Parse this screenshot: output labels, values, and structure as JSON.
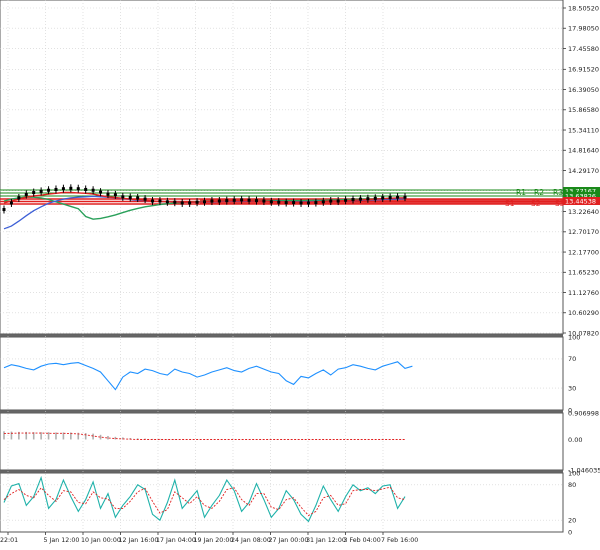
{
  "chart_data": {
    "type": "line",
    "main": {
      "y_ticks": [
        "18.50520",
        "17.98050",
        "17.45580",
        "16.91520",
        "16.39050",
        "15.86580",
        "15.34110",
        "14.81640",
        "14.29170",
        "13.76700",
        "13.22640",
        "12.70170",
        "12.17700",
        "11.65230",
        "11.12760",
        "10.60290",
        "10.07820"
      ],
      "y_tick_values": [
        18.5052,
        17.9805,
        17.4558,
        16.9152,
        16.3905,
        15.8658,
        15.3411,
        14.8164,
        14.2917,
        13.767,
        13.2264,
        12.7017,
        12.177,
        11.6523,
        11.1276,
        10.6029,
        10.0782
      ],
      "ylim": [
        10.0782,
        18.5052
      ],
      "current_price_labels": [
        "13.77167",
        "13.63826",
        "13.44538"
      ],
      "level_labels": [
        "R1",
        "R2",
        "R3",
        "S1",
        "S2",
        "S3"
      ],
      "price_series": [
        13.28,
        13.45,
        13.58,
        13.67,
        13.72,
        13.75,
        13.78,
        13.8,
        13.82,
        13.83,
        13.82,
        13.8,
        13.78,
        13.73,
        13.68,
        13.66,
        13.61,
        13.59,
        13.58,
        13.55,
        13.5,
        13.5,
        13.48,
        13.47,
        13.45,
        13.45,
        13.47,
        13.48,
        13.5,
        13.5,
        13.51,
        13.52,
        13.53,
        13.52,
        13.51,
        13.5,
        13.48,
        13.47,
        13.46,
        13.46,
        13.45,
        13.45,
        13.46,
        13.48,
        13.5,
        13.5,
        13.52,
        13.54,
        13.55,
        13.56,
        13.57,
        13.58,
        13.59,
        13.6,
        13.6
      ],
      "ma_blue": [
        12.78,
        12.85,
        12.98,
        13.12,
        13.25,
        13.35,
        13.44,
        13.5,
        13.55,
        13.58,
        13.6,
        13.61,
        13.62,
        13.61,
        13.6,
        13.58,
        13.56,
        13.54,
        13.52,
        13.51,
        13.5,
        13.49,
        13.48,
        13.48,
        13.47,
        13.47,
        13.47,
        13.48,
        13.48,
        13.49,
        13.49,
        13.5,
        13.5,
        13.5,
        13.5,
        13.5,
        13.49,
        13.49,
        13.48,
        13.48,
        13.48,
        13.48,
        13.49,
        13.49,
        13.5,
        13.5,
        13.51,
        13.51,
        13.52,
        13.53,
        13.53,
        13.54,
        13.55,
        13.55,
        13.56
      ],
      "ma_red": [
        13.45,
        13.5,
        13.55,
        13.6,
        13.63,
        13.65,
        13.68,
        13.7,
        13.72,
        13.72,
        13.71,
        13.7,
        13.68,
        13.64,
        13.61,
        13.59,
        13.57,
        13.55,
        13.54,
        13.52,
        13.5,
        13.49,
        13.48,
        13.48,
        13.47,
        13.47,
        13.47,
        13.48,
        13.49,
        13.5,
        13.5,
        13.51,
        13.51,
        13.51,
        13.5,
        13.5,
        13.49,
        13.48,
        13.48,
        13.47,
        13.47,
        13.47,
        13.48,
        13.49,
        13.5,
        13.5,
        13.51,
        13.52,
        13.53,
        13.54,
        13.55,
        13.56,
        13.57,
        13.58,
        13.58
      ],
      "ma_green": [
        13.5,
        13.55,
        13.58,
        13.6,
        13.6,
        13.58,
        13.54,
        13.48,
        13.42,
        13.36,
        13.3,
        13.1,
        13.03,
        13.05,
        13.09,
        13.14,
        13.2,
        13.26,
        13.31,
        13.35,
        13.38,
        13.41,
        13.43,
        13.45,
        13.46,
        13.47,
        13.48,
        13.49,
        13.49,
        13.5,
        13.5,
        13.51,
        13.51,
        13.51,
        13.51,
        13.51,
        13.51,
        13.51,
        13.51,
        13.51,
        13.51,
        13.52,
        13.52,
        13.52,
        13.53,
        13.53,
        13.54,
        13.54,
        13.55,
        13.55,
        13.56,
        13.56,
        13.57,
        13.57,
        13.58
      ]
    },
    "rsi": {
      "y_ticks": [
        "100",
        "70",
        "30",
        "0"
      ],
      "y_tick_values": [
        100,
        70,
        30,
        0
      ],
      "ylim": [
        0,
        100
      ],
      "values": [
        58,
        62,
        60,
        57,
        55,
        60,
        63,
        64,
        62,
        64,
        65,
        61,
        57,
        52,
        40,
        28,
        45,
        52,
        50,
        56,
        54,
        50,
        48,
        56,
        52,
        50,
        45,
        48,
        52,
        55,
        58,
        54,
        52,
        57,
        60,
        56,
        52,
        50,
        40,
        35,
        46,
        44,
        50,
        55,
        48,
        56,
        58,
        62,
        60,
        57,
        55,
        60,
        63,
        66,
        57,
        60
      ]
    },
    "macd": {
      "y_ticks": [
        "0.906998",
        "0.00",
        "-1.046035"
      ],
      "y_tick_values": [
        0.906998,
        0.0,
        -1.046035
      ],
      "ylim": [
        -1.046035,
        0.906998
      ],
      "histogram": [
        0.28,
        0.27,
        0.26,
        0.26,
        0.25,
        0.25,
        0.25,
        0.24,
        0.24,
        0.24,
        0.23,
        0.22,
        0.2,
        0.16,
        0.12,
        0.09,
        0.07,
        0.05,
        0.04,
        0.03,
        0.02,
        0.02,
        0.01,
        0.01,
        0.0,
        0.0,
        0.0,
        0.0,
        0.0,
        0.0,
        0.0,
        0.0,
        0.0,
        0.0,
        0.0,
        0.0,
        0.0,
        0.0,
        0.0,
        0.0,
        0.0,
        0.0,
        0.0,
        0.0,
        0.0,
        0.0,
        0.0,
        0.0,
        0.0,
        0.0,
        0.0,
        0.0,
        0.0,
        0.0,
        0.0
      ],
      "signal": [
        0.2,
        0.21,
        0.22,
        0.22,
        0.22,
        0.22,
        0.21,
        0.21,
        0.21,
        0.2,
        0.19,
        0.16,
        0.12,
        0.08,
        0.05,
        0.03,
        0.02,
        0.01,
        0.0,
        0.0,
        0.0,
        0.0,
        0.0,
        0.0,
        0.0,
        0.0,
        0.0,
        0.0,
        0.0,
        0.0,
        0.0,
        0.0,
        0.0,
        0.0,
        0.0,
        0.0,
        0.0,
        0.0,
        0.0,
        0.0,
        0.0,
        0.0,
        0.0,
        0.0,
        0.0,
        0.0,
        0.0,
        0.0,
        0.0,
        0.0,
        0.0,
        0.0,
        0.0,
        0.0,
        0.0
      ]
    },
    "stoch": {
      "y_ticks": [
        "100",
        "80",
        "20",
        "0"
      ],
      "y_tick_values": [
        100,
        80,
        20,
        0
      ],
      "ylim": [
        0,
        100
      ],
      "main_line": [
        50,
        78,
        82,
        45,
        60,
        92,
        40,
        55,
        88,
        60,
        35,
        55,
        85,
        40,
        65,
        25,
        45,
        60,
        80,
        72,
        30,
        20,
        50,
        88,
        40,
        55,
        70,
        25,
        45,
        62,
        88,
        70,
        35,
        50,
        82,
        55,
        25,
        40,
        70,
        55,
        30,
        18,
        45,
        78,
        55,
        35,
        60,
        80,
        70,
        75,
        65,
        78,
        80,
        40,
        60
      ],
      "signal_line": [
        55,
        65,
        72,
        62,
        58,
        75,
        62,
        52,
        70,
        68,
        50,
        48,
        68,
        58,
        56,
        40,
        40,
        52,
        68,
        74,
        52,
        32,
        38,
        68,
        58,
        48,
        60,
        45,
        40,
        52,
        72,
        75,
        55,
        45,
        65,
        65,
        42,
        38,
        55,
        58,
        42,
        28,
        35,
        58,
        62,
        45,
        48,
        70,
        72,
        72,
        70,
        73,
        76,
        58,
        55
      ]
    },
    "x_ticks": [
      "22:01",
      "5 Jan 12:00",
      "10 Jan 00:00",
      "12 Jan 16:00",
      "17 Jan 04:00",
      "19 Jan 20:00",
      "24 Jan 08:00",
      "27 Jan 00:00",
      "31 Jan 12:00",
      "3 Feb 04:00",
      "7 Feb 16:00"
    ],
    "colors": {
      "price": "#000000",
      "ma_blue": "#3d5fd6",
      "ma_red": "#e02020",
      "ma_green": "#2aa05a",
      "rsi": "#1e90ff",
      "macd_hist": "#b0b0b0",
      "macd_signal": "#e02020",
      "stoch_main": "#20b2aa",
      "stoch_signal": "#e02020",
      "resistance": "#1a8a1a",
      "support": "#e02020",
      "grid": "#d0d0d0"
    }
  }
}
